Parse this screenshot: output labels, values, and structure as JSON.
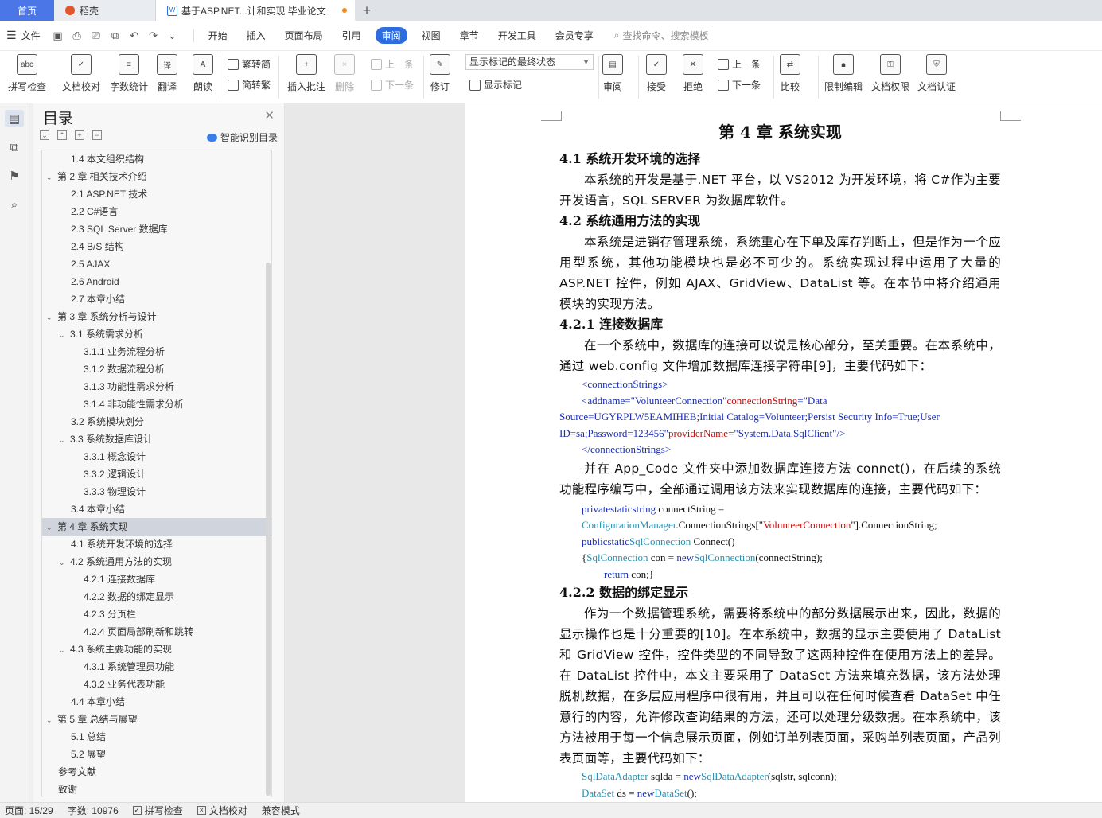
{
  "tabs": {
    "home": "首页",
    "daoke": "稻壳",
    "doc": "基于ASP.NET...计和实现 毕业论文",
    "add": "+"
  },
  "menu": {
    "file": "文件",
    "items": [
      "开始",
      "插入",
      "页面布局",
      "引用",
      "审阅",
      "视图",
      "章节",
      "开发工具",
      "会员专享"
    ],
    "active": "审阅",
    "search": "查找命令、搜索模板"
  },
  "ribbon": {
    "spell": "拼写检查",
    "proof": "文档校对",
    "wordcount": "字数统计",
    "translate": "翻译",
    "read": "朗读",
    "t2s": "繁转简",
    "s2t": "简转繁",
    "insert_comment": "插入批注",
    "delete": "删除",
    "prev": "上一条",
    "next": "下一条",
    "revise": "修订",
    "markup_select": "显示标记的最终状态",
    "show_markup": "显示标记",
    "review": "审阅",
    "accept": "接受",
    "reject": "拒绝",
    "prev2": "上一条",
    "next2": "下一条",
    "compare": "比较",
    "restrict": "限制编辑",
    "perm": "文档权限",
    "cert": "文档认证"
  },
  "toc": {
    "title": "目录",
    "smart": "智能识别目录",
    "items": [
      {
        "label": "1.4  本文组织结构",
        "level": 2
      },
      {
        "label": "第 2 章  相关技术介绍",
        "level": 1,
        "caret": true
      },
      {
        "label": "2.1 ASP.NET 技术",
        "level": 2
      },
      {
        "label": "2.2 C#语言",
        "level": 2
      },
      {
        "label": "2.3 SQL Server 数据库",
        "level": 2
      },
      {
        "label": "2.4 B/S 结构",
        "level": 2
      },
      {
        "label": "2.5 AJAX",
        "level": 2
      },
      {
        "label": "2.6 Android",
        "level": 2
      },
      {
        "label": "2.7 本章小结",
        "level": 2
      },
      {
        "label": "第 3 章  系统分析与设计",
        "level": 1,
        "caret": true
      },
      {
        "label": "3.1  系统需求分析",
        "level": 2,
        "caret": true
      },
      {
        "label": "3.1.1  业务流程分析",
        "level": 3
      },
      {
        "label": "3.1.2  数据流程分析",
        "level": 3
      },
      {
        "label": "3.1.3  功能性需求分析",
        "level": 3
      },
      {
        "label": "3.1.4  非功能性需求分析",
        "level": 3
      },
      {
        "label": "3.2  系统模块划分",
        "level": 2
      },
      {
        "label": "3.3  系统数据库设计",
        "level": 2,
        "caret": true
      },
      {
        "label": "3.3.1  概念设计",
        "level": 3
      },
      {
        "label": "3.3.2  逻辑设计",
        "level": 3
      },
      {
        "label": "3.3.3  物理设计",
        "level": 3
      },
      {
        "label": "3.4  本章小结",
        "level": 2
      },
      {
        "label": "第 4 章  系统实现",
        "level": 1,
        "caret": true,
        "selected": true
      },
      {
        "label": "4.1  系统开发环境的选择",
        "level": 2
      },
      {
        "label": "4.2  系统通用方法的实现",
        "level": 2,
        "caret": true
      },
      {
        "label": "4.2.1  连接数据库",
        "level": 3
      },
      {
        "label": "4.2.2  数据的绑定显示",
        "level": 3
      },
      {
        "label": "4.2.3  分页栏",
        "level": 3
      },
      {
        "label": "4.2.4  页面局部刷新和跳转",
        "level": 3
      },
      {
        "label": "4.3  系统主要功能的实现",
        "level": 2,
        "caret": true
      },
      {
        "label": "4.3.1  系统管理员功能",
        "level": 3
      },
      {
        "label": "4.3.2  业务代表功能",
        "level": 3
      },
      {
        "label": "4.4  本章小结",
        "level": 2
      },
      {
        "label": "第 5 章  总结与展望",
        "level": 1,
        "caret": true
      },
      {
        "label": "5.1  总结",
        "level": 2
      },
      {
        "label": "5.2  展望",
        "level": 2
      },
      {
        "label": "参考文献",
        "level": 1
      },
      {
        "label": "致谢",
        "level": 1
      }
    ]
  },
  "doc": {
    "chapter": "第 4 章  系统实现",
    "h41": "4.1  系统开发环境的选择",
    "p41": "本系统的开发是基于.NET 平台，以 VS2012 为开发环境，将 C#作为主要开发语言，SQL SERVER 为数据库软件。",
    "h42": "4.2  系统通用方法的实现",
    "p42": "本系统是进销存管理系统，系统重心在下单及库存判断上，但是作为一个应用型系统，其他功能模块也是必不可少的。系统实现过程中运用了大量的 ASP.NET 控件，例如 AJAX、GridView、DataList 等。在本节中将介绍通用模块的实现方法。",
    "h421": "4.2.1  连接数据库",
    "p421": "在一个系统中，数据库的连接可以说是核心部分，至关重要。在本系统中，通过 web.config 文件增加数据库连接字符串[9]，主要代码如下：",
    "code1": {
      "l1": "<connectionStrings>",
      "l2a": "<addname=\"",
      "l2b": "VolunteerConnection",
      "l2c": "\"",
      "l2d": "connectionString",
      "l2e": "=\"Data",
      "l3": "Source=UGYRPLW5EAMIHEB;Initial Catalog=Volunteer;Persist Security Info=True;User",
      "l4a": "ID=sa;Password=123456\"",
      "l4b": "providerName",
      "l4c": "=\"System.Data.SqlClient\"/>",
      "l5": "</connectionStrings>"
    },
    "p421b": "并在 App_Code 文件夹中添加数据库连接方法 connet()，在后续的系统功能程序编写中，全部通过调用该方法来实现数据库的连接，主要代码如下：",
    "code2": {
      "l1a": "privatestaticstring",
      "l1b": " connectString =",
      "l2a": "ConfigurationManager",
      "l2b": ".ConnectionStrings[\"",
      "l2c": "VolunteerConnection",
      "l2d": "\"].ConnectionString;",
      "l3a": " publicstatic",
      "l3b": "SqlConnection",
      "l3c": " Connect()",
      "l4a": "{",
      "l4b": "SqlConnection",
      "l4c": " con = ",
      "l4d": "new",
      "l4e": "SqlConnection",
      "l4f": "(connectString);",
      "l5a": "return",
      "l5b": " con;}"
    },
    "h422": "4.2.2  数据的绑定显示",
    "p422": "作为一个数据管理系统，需要将系统中的部分数据展示出来，因此，数据的显示操作也是十分重要的[10]。在本系统中，数据的显示主要使用了 DataList 和 GridView 控件，控件类型的不同导致了这两种控件在使用方法上的差异。在 DataList 控件中，本文主要采用了 DataSet 方法来填充数据，该方法处理脱机数据，在多层应用程序中很有用，并且可以在任何时候查看 DataSet 中任意行的内容，允许修改查询结果的方法，还可以处理分级数据。在本系统中，该方法被用于每一个信息展示页面，例如订单列表页面，采购单列表页面，产品列表页面等，主要代码如下：",
    "code3": {
      "l1a": "SqlDataAdapter",
      "l1b": " sqlda = ",
      "l1c": "new",
      "l1d": "SqlDataAdapter",
      "l1e": "(sqlstr, sqlconn);",
      "l2a": "DataSet",
      "l2b": " ds = ",
      "l2c": "new",
      "l2d": "DataSet",
      "l2e": "();"
    }
  },
  "status": {
    "page": "页面: 15/29",
    "words": "字数: 10976",
    "spell": "拼写检查",
    "proof": "文档校对",
    "compat": "兼容模式"
  }
}
